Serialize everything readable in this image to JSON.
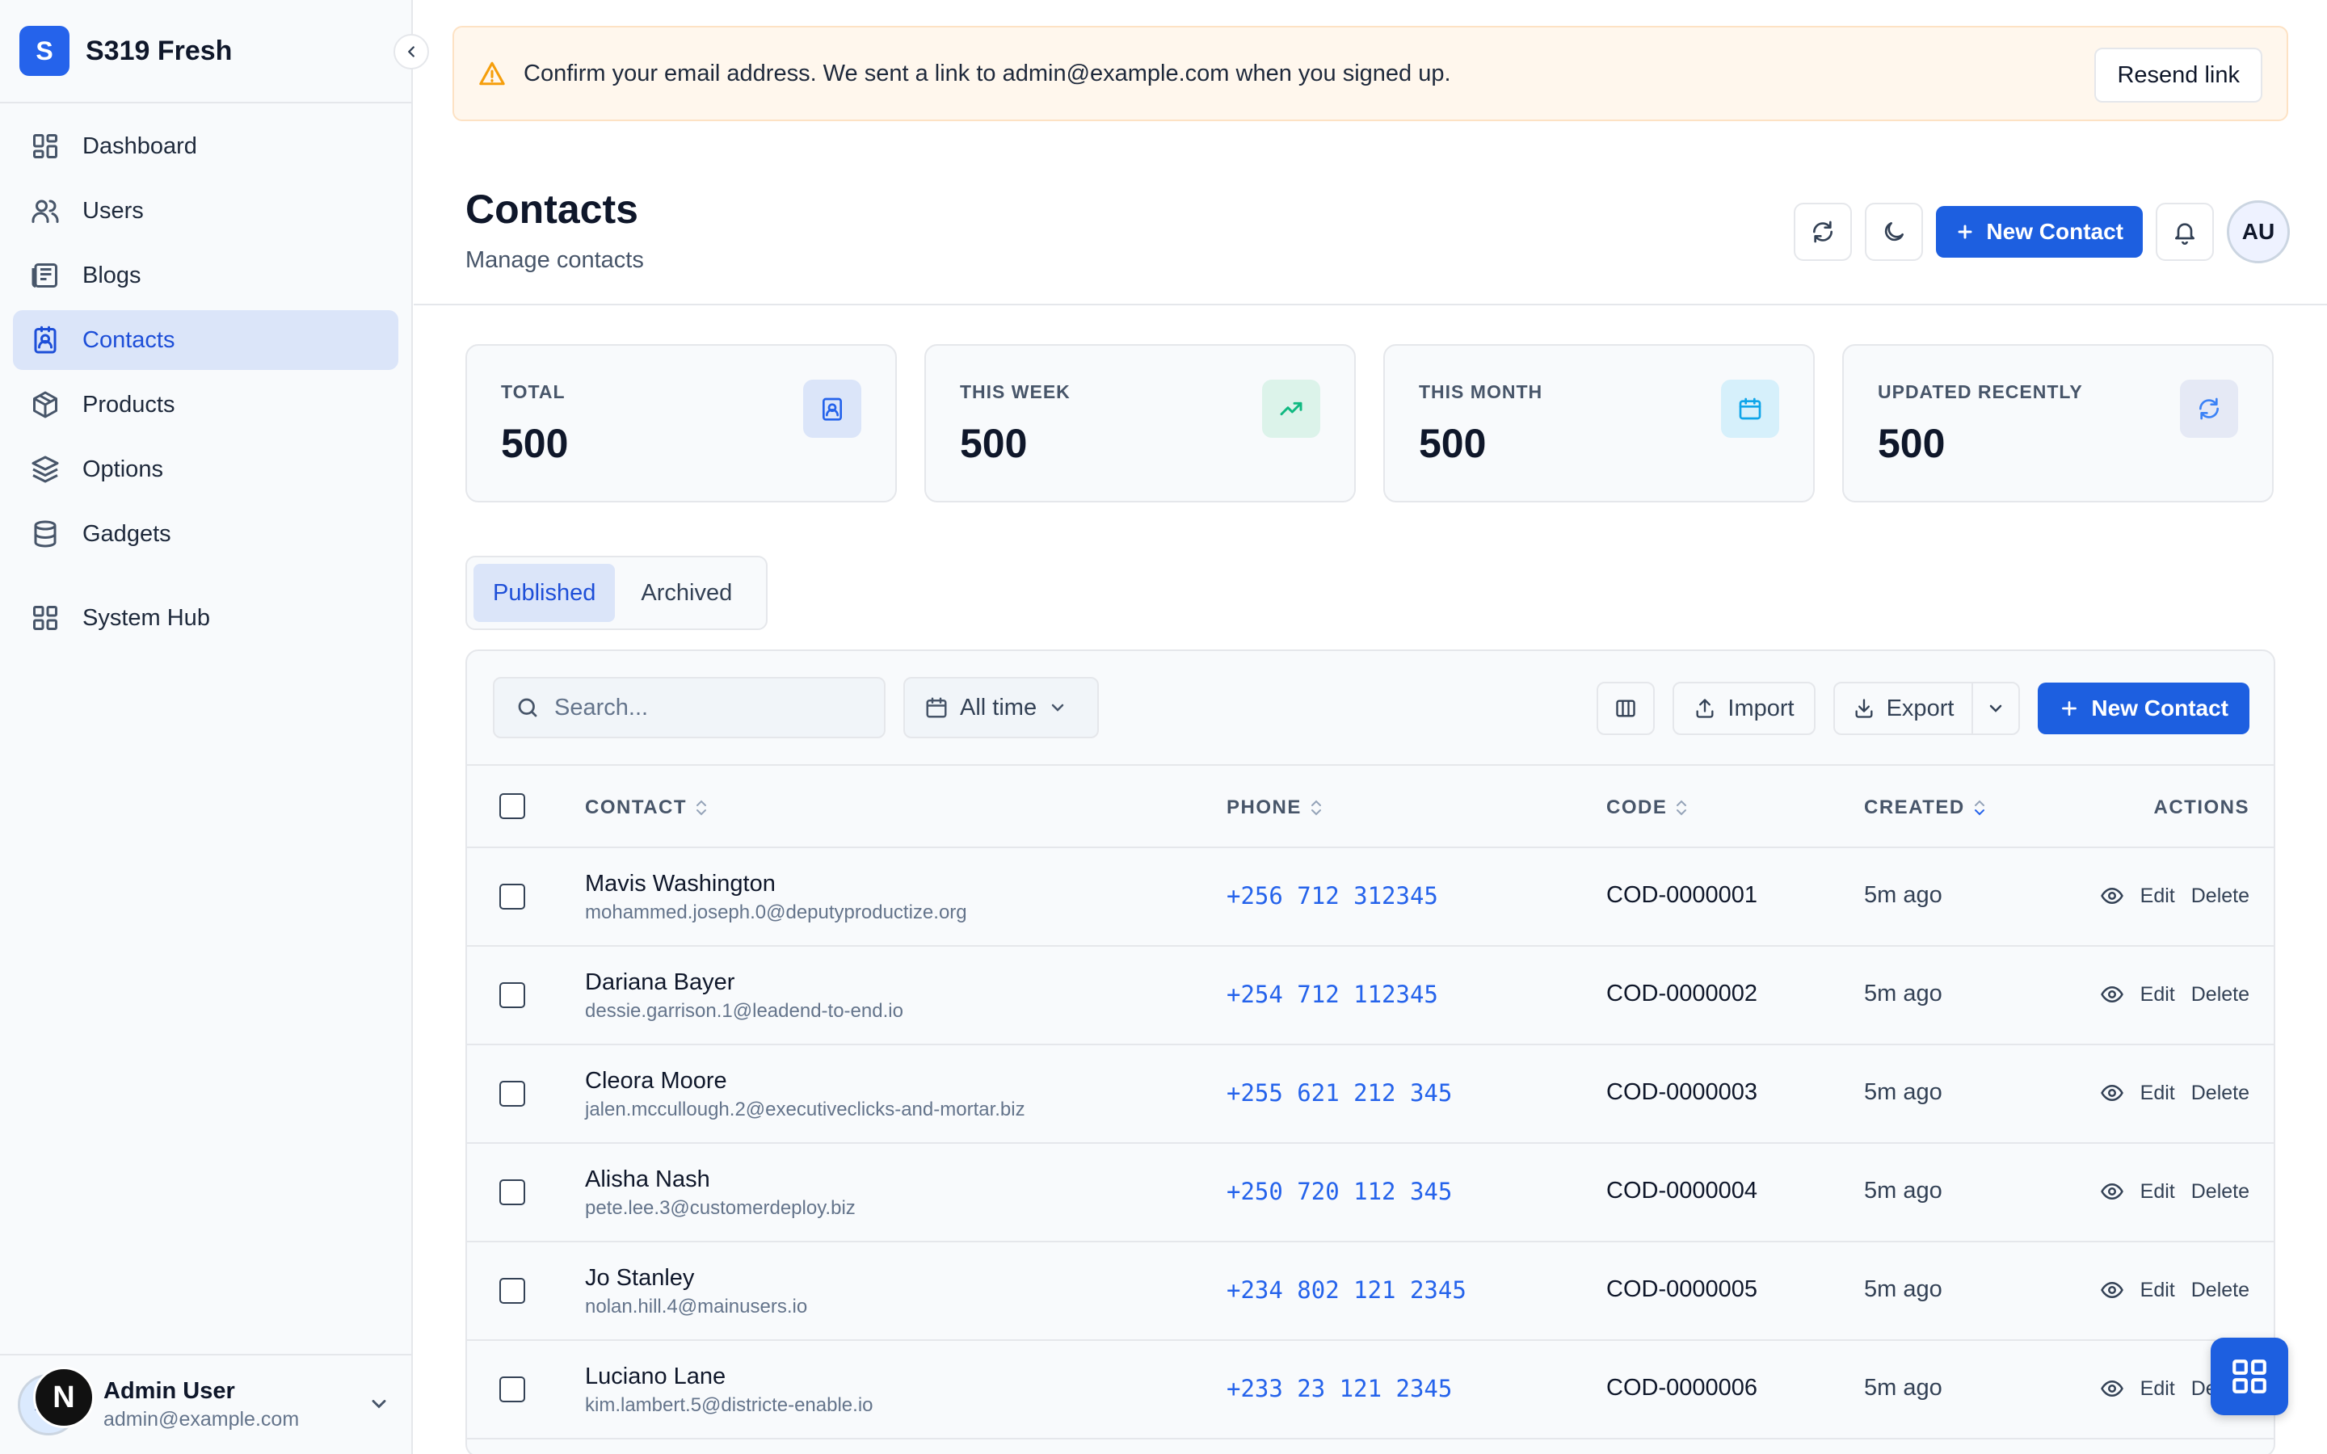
{
  "app": {
    "logo_letter": "S",
    "name": "S319 Fresh"
  },
  "sidebar": {
    "items": [
      {
        "label": "Dashboard",
        "icon": "dashboard-icon"
      },
      {
        "label": "Users",
        "icon": "users-icon"
      },
      {
        "label": "Blogs",
        "icon": "blogs-icon"
      },
      {
        "label": "Contacts",
        "icon": "contacts-icon",
        "active": true
      },
      {
        "label": "Products",
        "icon": "box-icon"
      },
      {
        "label": "Options",
        "icon": "layers-icon"
      },
      {
        "label": "Gadgets",
        "icon": "database-icon"
      },
      {
        "label": "System Hub",
        "icon": "grid-icon"
      }
    ],
    "user": {
      "initials": "AU",
      "badge": "N",
      "name": "Admin User",
      "email": "admin@example.com"
    }
  },
  "banner": {
    "text": "Confirm your email address. We sent a link to admin@example.com when you signed up.",
    "button": "Resend link"
  },
  "header": {
    "title": "Contacts",
    "subtitle": "Manage contacts",
    "new_button": "New Contact",
    "avatar_initials": "AU"
  },
  "stats": [
    {
      "label": "TOTAL",
      "value": "500",
      "icon": "contact-card-icon",
      "color": "#dbe5f9"
    },
    {
      "label": "THIS WEEK",
      "value": "500",
      "icon": "trending-up-icon",
      "color": "#dcf3ea"
    },
    {
      "label": "THIS MONTH",
      "value": "500",
      "icon": "calendar-icon",
      "color": "#d6f0fb"
    },
    {
      "label": "UPDATED RECENTLY",
      "value": "500",
      "icon": "refresh-icon",
      "color": "#e5e9f5"
    }
  ],
  "tabs": [
    {
      "label": "Published",
      "active": true
    },
    {
      "label": "Archived",
      "active": false
    }
  ],
  "toolbar": {
    "search_placeholder": "Search...",
    "date_filter": "All time",
    "import_label": "Import",
    "export_label": "Export",
    "new_button": "New Contact"
  },
  "table": {
    "columns": {
      "contact": "CONTACT",
      "phone": "PHONE",
      "code": "CODE",
      "created": "CREATED",
      "actions": "ACTIONS"
    },
    "action_labels": {
      "edit": "Edit",
      "delete": "Delete"
    },
    "rows": [
      {
        "name": "Mavis Washington",
        "email": "mohammed.joseph.0@deputyproductize.org",
        "phone": "+256 712 312345",
        "code": "COD-0000001",
        "created": "5m ago"
      },
      {
        "name": "Dariana Bayer",
        "email": "dessie.garrison.1@leadend-to-end.io",
        "phone": "+254 712 112345",
        "code": "COD-0000002",
        "created": "5m ago"
      },
      {
        "name": "Cleora Moore",
        "email": "jalen.mccullough.2@executiveclicks-and-mortar.biz",
        "phone": "+255 621 212 345",
        "code": "COD-0000003",
        "created": "5m ago"
      },
      {
        "name": "Alisha Nash",
        "email": "pete.lee.3@customerdeploy.biz",
        "phone": "+250 720 112 345",
        "code": "COD-0000004",
        "created": "5m ago"
      },
      {
        "name": "Jo Stanley",
        "email": "nolan.hill.4@mainusers.io",
        "phone": "+234 802 121 2345",
        "code": "COD-0000005",
        "created": "5m ago"
      },
      {
        "name": "Luciano Lane",
        "email": "kim.lambert.5@districte-enable.io",
        "phone": "+233 23 121 2345",
        "code": "COD-0000006",
        "created": "5m ago"
      }
    ]
  },
  "colors": {
    "primary": "#1d5fe0",
    "active_bg": "#dbe5f9",
    "warning": "#f59e0b"
  }
}
